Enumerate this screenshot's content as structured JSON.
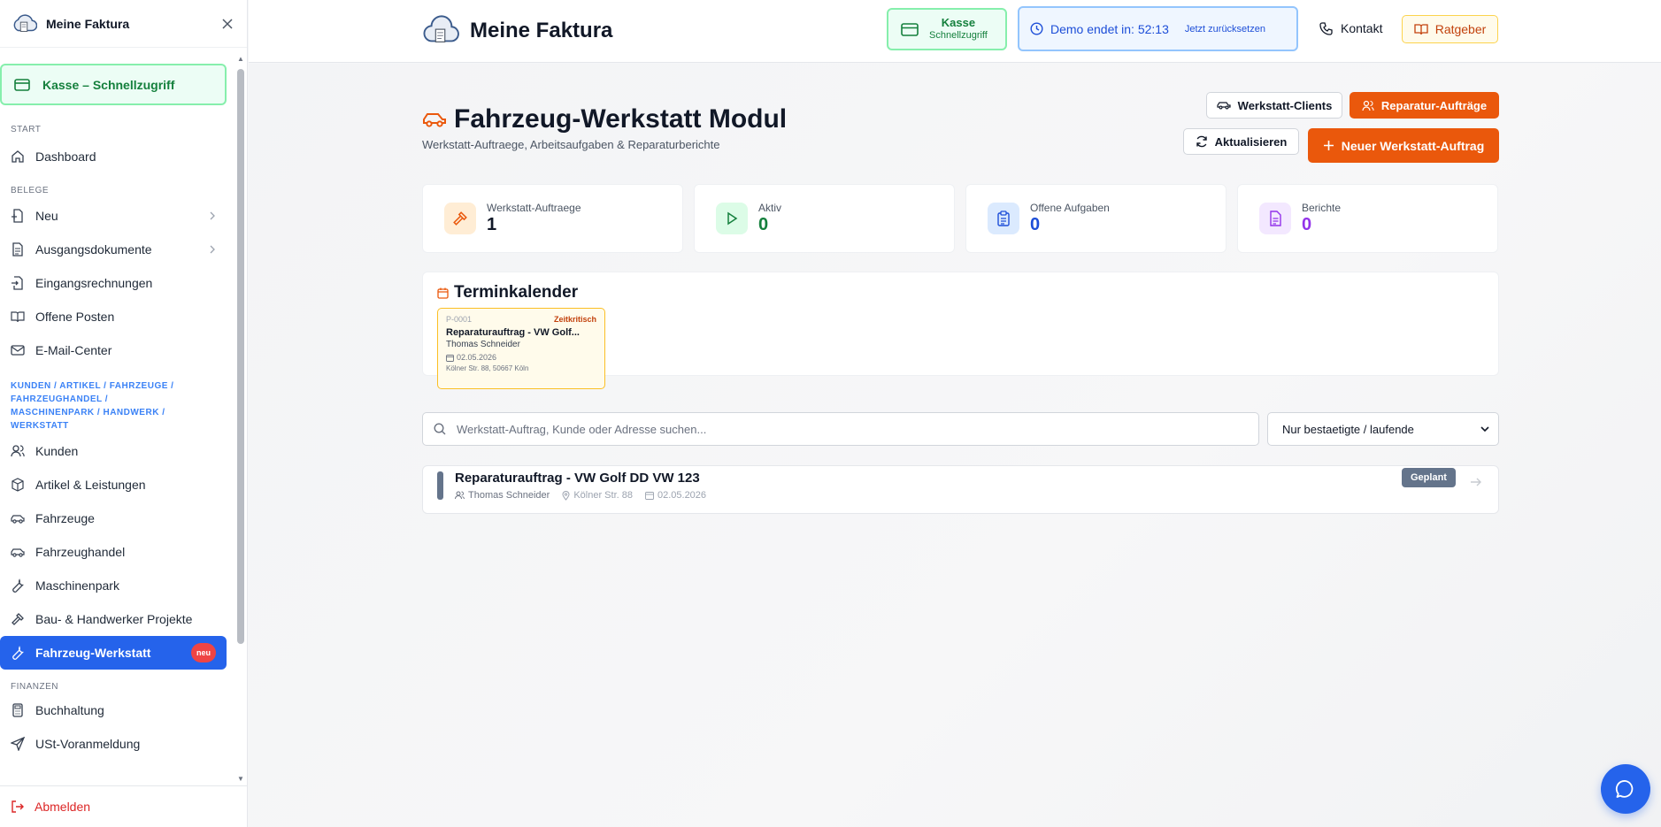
{
  "app": {
    "name": "Meine Faktura"
  },
  "sidebar": {
    "title": "Meine Faktura",
    "quick_kasse": "Kasse – Schnellzugriff",
    "sections": {
      "start": "START",
      "belege": "BELEGE",
      "kunden": "KUNDEN / ARTIKEL / FAHRZEUGE / FAHRZEUGHANDEL / MASCHINENPARK / HANDWERK / WERKSTATT",
      "finanzen": "FINANZEN"
    },
    "items": {
      "dashboard": "Dashboard",
      "neu": "Neu",
      "ausgang": "Ausgangsdokumente",
      "eingang": "Eingangsrechnungen",
      "offene": "Offene Posten",
      "email": "E-Mail-Center",
      "kunden": "Kunden",
      "artikel": "Artikel & Leistungen",
      "fahrzeuge": "Fahrzeuge",
      "fahrzeughandel": "Fahrzeughandel",
      "maschinenpark": "Maschinenpark",
      "bau": "Bau- & Handwerker Projekte",
      "werkstatt": "Fahrzeug-Werkstatt",
      "buchhaltung": "Buchhaltung",
      "ust": "USt-Voranmeldung"
    },
    "werkstatt_badge": "neu",
    "logout": "Abmelden"
  },
  "topbar": {
    "brand": "Meine Faktura",
    "kasse_title": "Kasse",
    "kasse_sub": "Schnellzugriff",
    "demo_text": "Demo endet in: 52:13",
    "demo_reset": "Jetzt zurücksetzen",
    "kontakt": "Kontakt",
    "ratgeber": "Ratgeber"
  },
  "page": {
    "title": "Fahrzeug-Werkstatt Modul",
    "subtitle": "Werkstatt-Auftraege, Arbeitsaufgaben & Reparaturberichte",
    "btn_clients": "Werkstatt-Clients",
    "btn_reparatur": "Reparatur-Aufträge",
    "btn_refresh": "Aktualisieren",
    "btn_new": "Neuer Werkstatt-Auftrag"
  },
  "stats": [
    {
      "label": "Werkstatt-Auftraege",
      "value": "1",
      "color": "#111827"
    },
    {
      "label": "Aktiv",
      "value": "0",
      "color": "#15803d"
    },
    {
      "label": "Offene Aufgaben",
      "value": "0",
      "color": "#1d4ed8"
    },
    {
      "label": "Berichte",
      "value": "0",
      "color": "#9333ea"
    }
  ],
  "calendar": {
    "title": "Terminkalender",
    "event": {
      "id": "P-0001",
      "tag": "Zeitkritisch",
      "title": "Reparaturauftrag - VW Golf...",
      "customer": "Thomas Schneider",
      "date": "02.05.2026",
      "address": "Kölner Str. 88, 50667 Köln"
    }
  },
  "search": {
    "placeholder": "Werkstatt-Auftrag, Kunde oder Adresse suchen...",
    "value": ""
  },
  "filter": {
    "selected": "Nur bestaetigte / laufende"
  },
  "orders": [
    {
      "title": "Reparaturauftrag - VW Golf DD VW 123",
      "customer": "Thomas Schneider",
      "address": "Kölner Str. 88",
      "date": "02.05.2026",
      "status": "Geplant"
    }
  ],
  "colors": {
    "accent": "#ea580c",
    "primary": "#2563eb",
    "success": "#15803d"
  }
}
